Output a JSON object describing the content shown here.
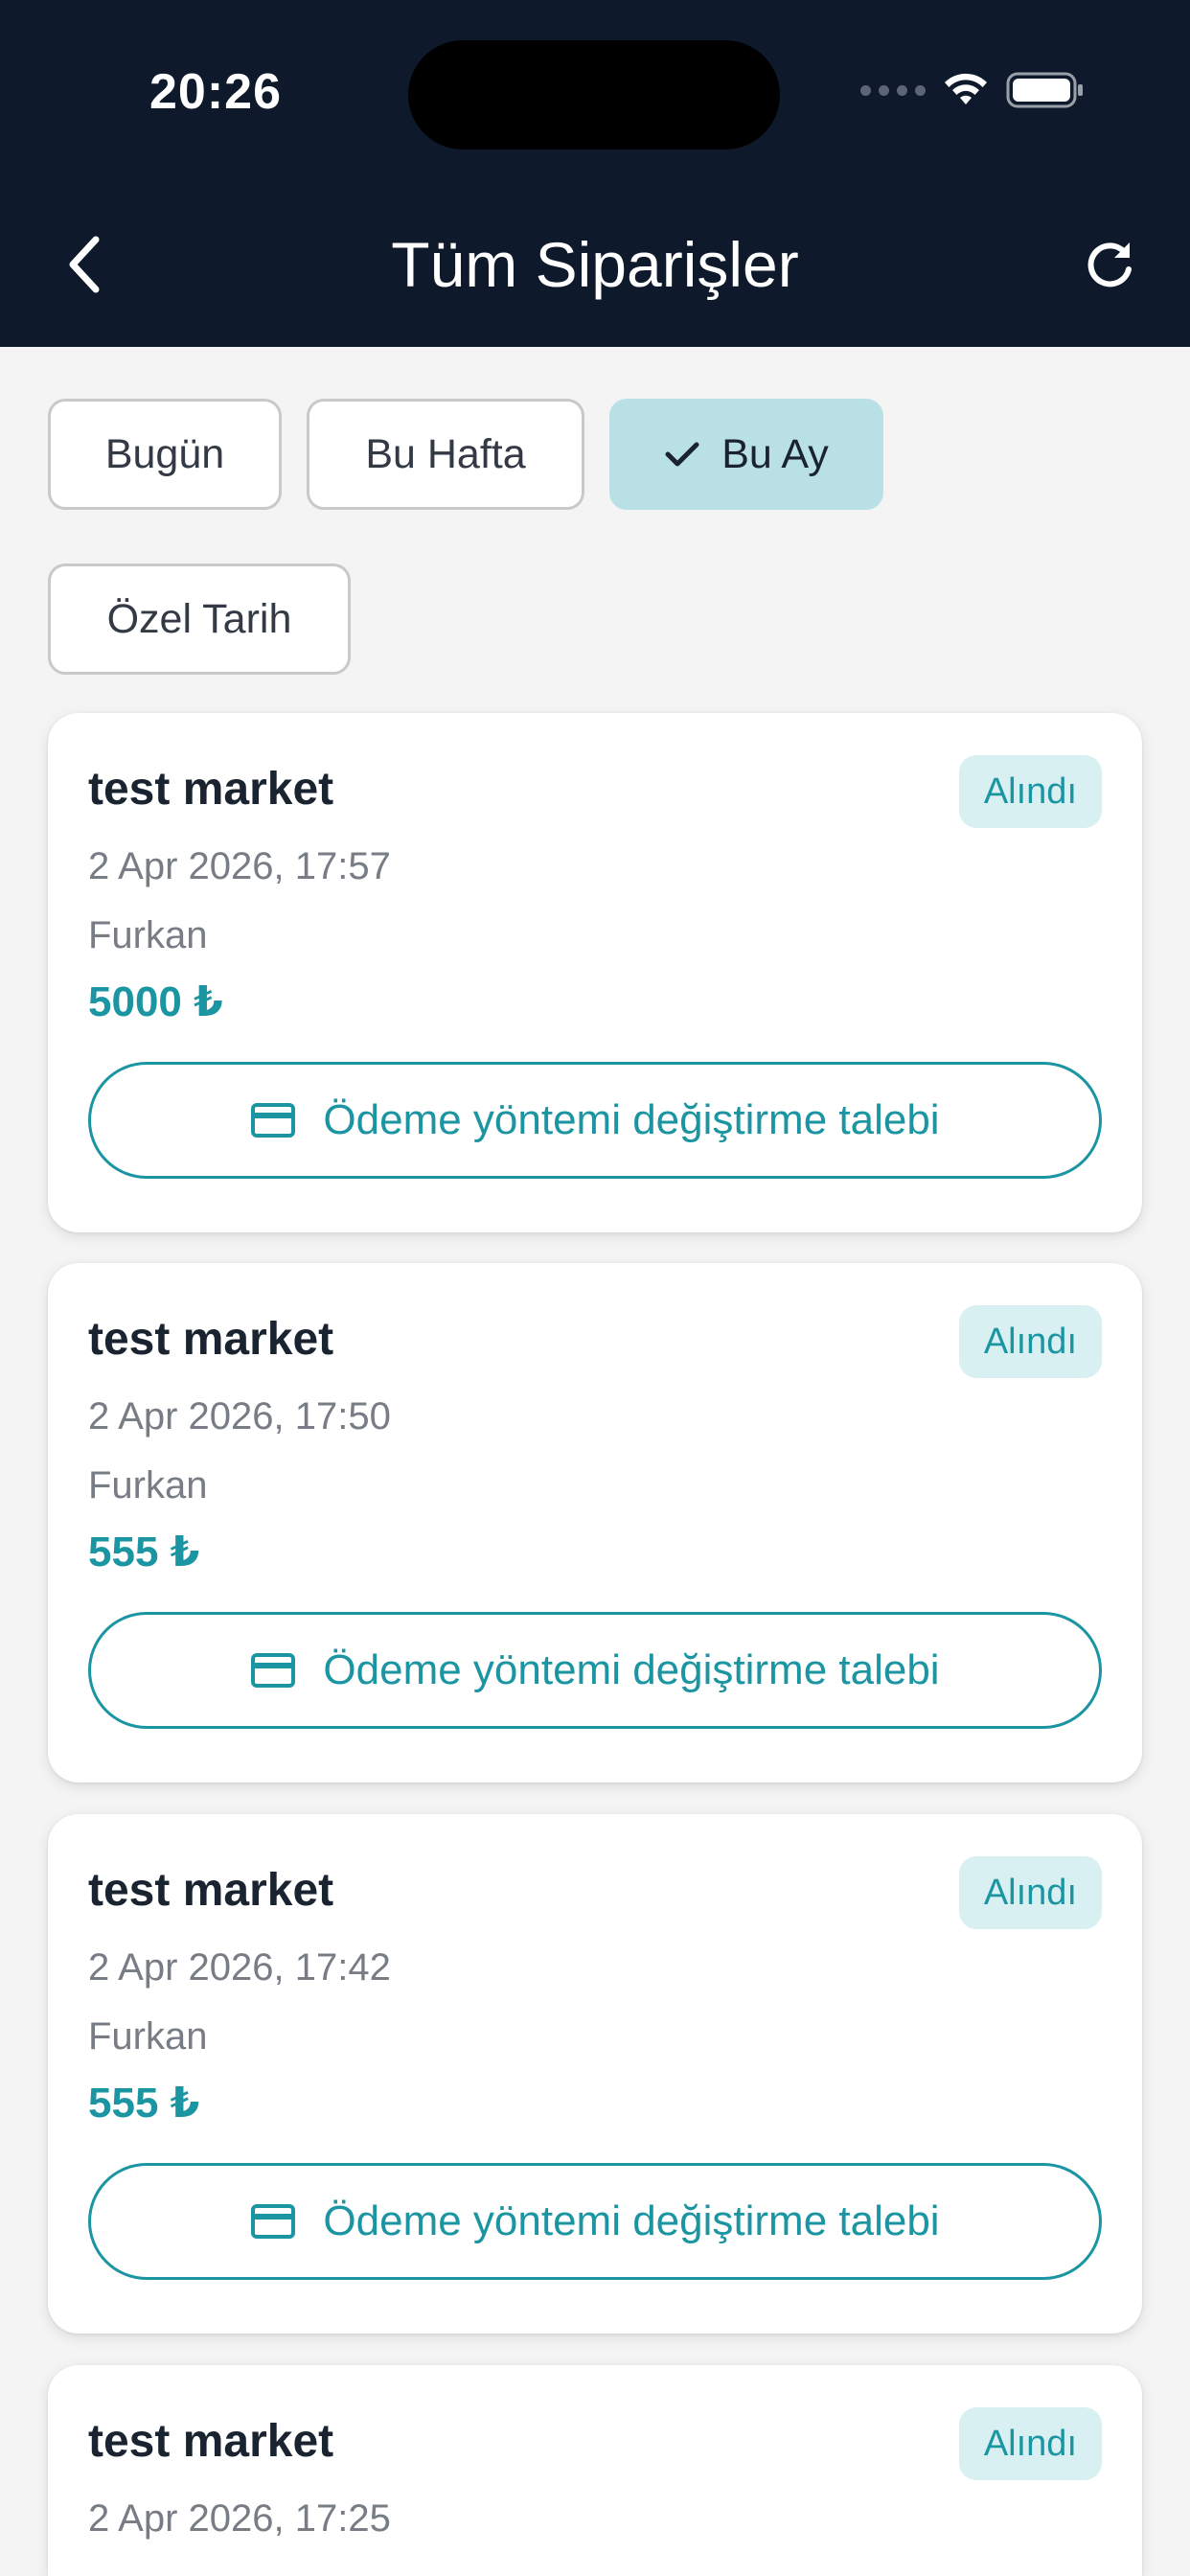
{
  "status_bar": {
    "time": "20:26"
  },
  "header": {
    "title": "Tüm Siparişler"
  },
  "filters": [
    {
      "label": "Bugün",
      "selected": false
    },
    {
      "label": "Bu Hafta",
      "selected": false
    },
    {
      "label": "Bu Ay",
      "selected": true
    },
    {
      "label": "Özel Tarih",
      "selected": false
    }
  ],
  "orders": [
    {
      "name": "test market",
      "status": "Alındı",
      "date": "2 Apr 2026, 17:57",
      "user": "Furkan",
      "amount": "5000 ₺",
      "action_label": "Ödeme yöntemi değiştirme talebi"
    },
    {
      "name": "test market",
      "status": "Alındı",
      "date": "2 Apr 2026, 17:50",
      "user": "Furkan",
      "amount": "555 ₺",
      "action_label": "Ödeme yöntemi değiştirme talebi"
    },
    {
      "name": "test market",
      "status": "Alındı",
      "date": "2 Apr 2026, 17:42",
      "user": "Furkan",
      "amount": "555 ₺",
      "action_label": "Ödeme yöntemi değiştirme talebi"
    },
    {
      "name": "test market",
      "status": "Alındı",
      "date": "2 Apr 2026, 17:25",
      "user": "",
      "amount": "",
      "action_label": ""
    }
  ],
  "colors": {
    "header_bg": "#0e1a2b",
    "accent": "#1b95a2",
    "chip_selected": "#b9e0e5",
    "badge_bg": "#d9f0f2"
  }
}
